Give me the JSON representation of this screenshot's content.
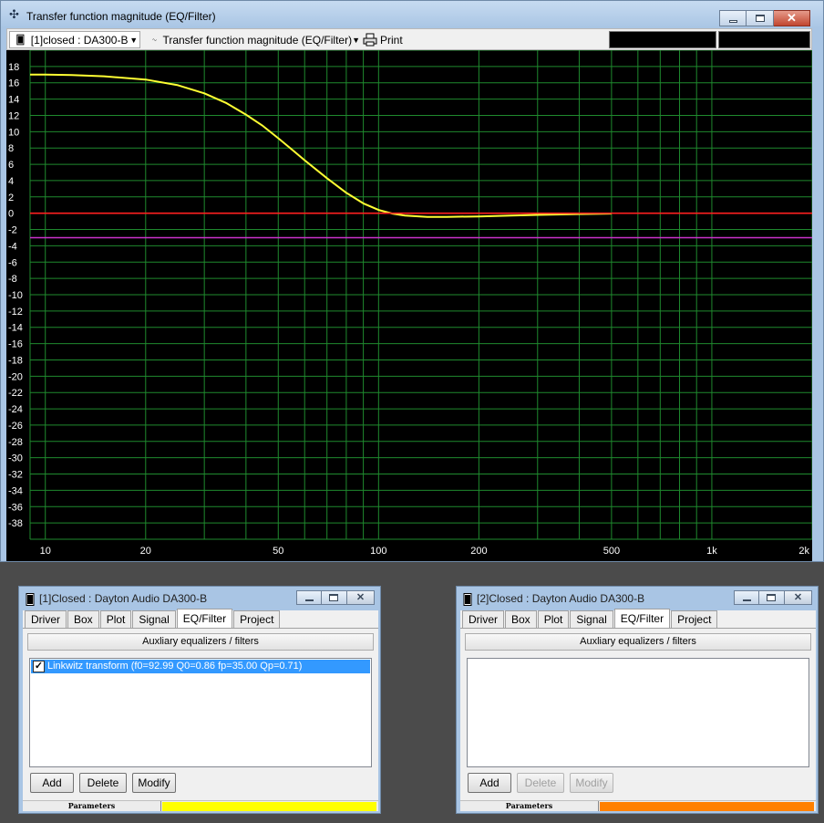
{
  "main_window": {
    "title": "Transfer function magnitude (EQ/Filter)",
    "toolbar": {
      "project_select": "[1]closed : DA300-B",
      "plot_select": "Transfer function magnitude (EQ/Filter)",
      "print_label": "Print"
    }
  },
  "chart_data": {
    "type": "line",
    "xscale": "log",
    "xlim": [
      9,
      2000
    ],
    "ylim": [
      -40,
      20
    ],
    "y_ticks": [
      18,
      16,
      14,
      12,
      10,
      8,
      6,
      4,
      2,
      0,
      -2,
      -4,
      -6,
      -8,
      -10,
      -12,
      -14,
      -16,
      -18,
      -20,
      -22,
      -24,
      -26,
      -28,
      -30,
      -32,
      -34,
      -36,
      -38
    ],
    "y_tick_labels": [
      "18",
      "16",
      "14",
      "12",
      "10",
      "8",
      "6",
      "4",
      "2",
      "0",
      "-2",
      "-4",
      "-6",
      "-8",
      "-10",
      "-12",
      "-14",
      "-16",
      "-18",
      "-20",
      "-22",
      "-24",
      "-26",
      "-28",
      "-30",
      "-32",
      "-34",
      "-36",
      "-38"
    ],
    "x_tick_labels": [
      {
        "value": 10,
        "label": "10"
      },
      {
        "value": 20,
        "label": "20"
      },
      {
        "value": 50,
        "label": "50"
      },
      {
        "value": 100,
        "label": "100"
      },
      {
        "value": 200,
        "label": "200"
      },
      {
        "value": 500,
        "label": "500"
      },
      {
        "value": 1000,
        "label": "1k"
      },
      {
        "value": 2000,
        "label": "2k"
      }
    ],
    "grid": true,
    "colors": {
      "background": "#000000",
      "grid": "#1f8a2e",
      "curve": "#ffff33",
      "zero_line": "#ff2020",
      "ref_line": "#cc33cc"
    },
    "series": [
      {
        "color": "#ffff33",
        "x": [
          9,
          10,
          12,
          15,
          20,
          25,
          30,
          35,
          40,
          45,
          50,
          55,
          60,
          70,
          80,
          90,
          100,
          110,
          120,
          140,
          160,
          200,
          250,
          300,
          400,
          500
        ],
        "y": [
          17.0,
          17.0,
          16.95,
          16.8,
          16.4,
          15.7,
          14.7,
          13.5,
          12.1,
          10.7,
          9.2,
          7.8,
          6.5,
          4.3,
          2.5,
          1.2,
          0.4,
          -0.05,
          -0.3,
          -0.45,
          -0.45,
          -0.4,
          -0.3,
          -0.2,
          -0.1,
          -0.05
        ]
      },
      {
        "color": "#ff2020",
        "x": [
          9,
          2000
        ],
        "y": [
          0,
          0
        ]
      },
      {
        "color": "#cc33cc",
        "x": [
          9,
          2000
        ],
        "y": [
          -3,
          -3
        ]
      }
    ]
  },
  "child_windows": [
    {
      "title": "[1]Closed : Dayton Audio DA300-B",
      "tabs": [
        "Driver",
        "Box",
        "Plot",
        "Signal",
        "EQ/Filter",
        "Project"
      ],
      "active_tab": "EQ/Filter",
      "aux_label": "Auxliary equalizers / filters",
      "list_items": [
        "Linkwitz transform (f0=92.99 Q0=0.86 fp=35.00 Qp=0.71)"
      ],
      "add_label": "Add",
      "delete_label": "Delete",
      "modify_label": "Modify",
      "params_label": "Parameters",
      "params_color": "#ffff00"
    },
    {
      "title": "[2]Closed : Dayton Audio DA300-B",
      "tabs": [
        "Driver",
        "Box",
        "Plot",
        "Signal",
        "EQ/Filter",
        "Project"
      ],
      "active_tab": "EQ/Filter",
      "aux_label": "Auxliary equalizers / filters",
      "list_items": [],
      "add_label": "Add",
      "delete_label": "Delete",
      "modify_label": "Modify",
      "params_label": "Parameters",
      "params_color": "#ff8000"
    }
  ]
}
